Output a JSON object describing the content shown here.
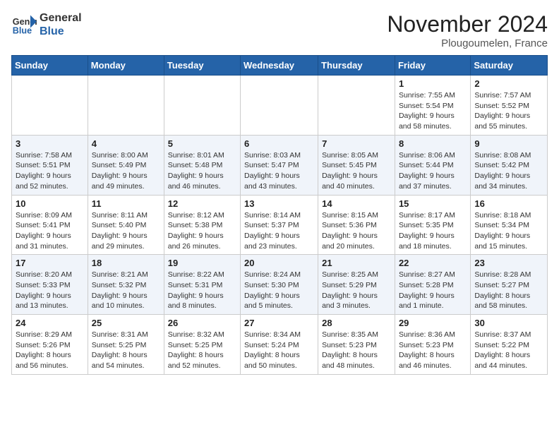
{
  "header": {
    "logo_line1": "General",
    "logo_line2": "Blue",
    "month_year": "November 2024",
    "location": "Plougoumelen, France"
  },
  "days_of_week": [
    "Sunday",
    "Monday",
    "Tuesday",
    "Wednesday",
    "Thursday",
    "Friday",
    "Saturday"
  ],
  "weeks": [
    [
      {
        "day": "",
        "info": ""
      },
      {
        "day": "",
        "info": ""
      },
      {
        "day": "",
        "info": ""
      },
      {
        "day": "",
        "info": ""
      },
      {
        "day": "",
        "info": ""
      },
      {
        "day": "1",
        "info": "Sunrise: 7:55 AM\nSunset: 5:54 PM\nDaylight: 9 hours and 58 minutes."
      },
      {
        "day": "2",
        "info": "Sunrise: 7:57 AM\nSunset: 5:52 PM\nDaylight: 9 hours and 55 minutes."
      }
    ],
    [
      {
        "day": "3",
        "info": "Sunrise: 7:58 AM\nSunset: 5:51 PM\nDaylight: 9 hours and 52 minutes."
      },
      {
        "day": "4",
        "info": "Sunrise: 8:00 AM\nSunset: 5:49 PM\nDaylight: 9 hours and 49 minutes."
      },
      {
        "day": "5",
        "info": "Sunrise: 8:01 AM\nSunset: 5:48 PM\nDaylight: 9 hours and 46 minutes."
      },
      {
        "day": "6",
        "info": "Sunrise: 8:03 AM\nSunset: 5:47 PM\nDaylight: 9 hours and 43 minutes."
      },
      {
        "day": "7",
        "info": "Sunrise: 8:05 AM\nSunset: 5:45 PM\nDaylight: 9 hours and 40 minutes."
      },
      {
        "day": "8",
        "info": "Sunrise: 8:06 AM\nSunset: 5:44 PM\nDaylight: 9 hours and 37 minutes."
      },
      {
        "day": "9",
        "info": "Sunrise: 8:08 AM\nSunset: 5:42 PM\nDaylight: 9 hours and 34 minutes."
      }
    ],
    [
      {
        "day": "10",
        "info": "Sunrise: 8:09 AM\nSunset: 5:41 PM\nDaylight: 9 hours and 31 minutes."
      },
      {
        "day": "11",
        "info": "Sunrise: 8:11 AM\nSunset: 5:40 PM\nDaylight: 9 hours and 29 minutes."
      },
      {
        "day": "12",
        "info": "Sunrise: 8:12 AM\nSunset: 5:38 PM\nDaylight: 9 hours and 26 minutes."
      },
      {
        "day": "13",
        "info": "Sunrise: 8:14 AM\nSunset: 5:37 PM\nDaylight: 9 hours and 23 minutes."
      },
      {
        "day": "14",
        "info": "Sunrise: 8:15 AM\nSunset: 5:36 PM\nDaylight: 9 hours and 20 minutes."
      },
      {
        "day": "15",
        "info": "Sunrise: 8:17 AM\nSunset: 5:35 PM\nDaylight: 9 hours and 18 minutes."
      },
      {
        "day": "16",
        "info": "Sunrise: 8:18 AM\nSunset: 5:34 PM\nDaylight: 9 hours and 15 minutes."
      }
    ],
    [
      {
        "day": "17",
        "info": "Sunrise: 8:20 AM\nSunset: 5:33 PM\nDaylight: 9 hours and 13 minutes."
      },
      {
        "day": "18",
        "info": "Sunrise: 8:21 AM\nSunset: 5:32 PM\nDaylight: 9 hours and 10 minutes."
      },
      {
        "day": "19",
        "info": "Sunrise: 8:22 AM\nSunset: 5:31 PM\nDaylight: 9 hours and 8 minutes."
      },
      {
        "day": "20",
        "info": "Sunrise: 8:24 AM\nSunset: 5:30 PM\nDaylight: 9 hours and 5 minutes."
      },
      {
        "day": "21",
        "info": "Sunrise: 8:25 AM\nSunset: 5:29 PM\nDaylight: 9 hours and 3 minutes."
      },
      {
        "day": "22",
        "info": "Sunrise: 8:27 AM\nSunset: 5:28 PM\nDaylight: 9 hours and 1 minute."
      },
      {
        "day": "23",
        "info": "Sunrise: 8:28 AM\nSunset: 5:27 PM\nDaylight: 8 hours and 58 minutes."
      }
    ],
    [
      {
        "day": "24",
        "info": "Sunrise: 8:29 AM\nSunset: 5:26 PM\nDaylight: 8 hours and 56 minutes."
      },
      {
        "day": "25",
        "info": "Sunrise: 8:31 AM\nSunset: 5:25 PM\nDaylight: 8 hours and 54 minutes."
      },
      {
        "day": "26",
        "info": "Sunrise: 8:32 AM\nSunset: 5:25 PM\nDaylight: 8 hours and 52 minutes."
      },
      {
        "day": "27",
        "info": "Sunrise: 8:34 AM\nSunset: 5:24 PM\nDaylight: 8 hours and 50 minutes."
      },
      {
        "day": "28",
        "info": "Sunrise: 8:35 AM\nSunset: 5:23 PM\nDaylight: 8 hours and 48 minutes."
      },
      {
        "day": "29",
        "info": "Sunrise: 8:36 AM\nSunset: 5:23 PM\nDaylight: 8 hours and 46 minutes."
      },
      {
        "day": "30",
        "info": "Sunrise: 8:37 AM\nSunset: 5:22 PM\nDaylight: 8 hours and 44 minutes."
      }
    ]
  ]
}
